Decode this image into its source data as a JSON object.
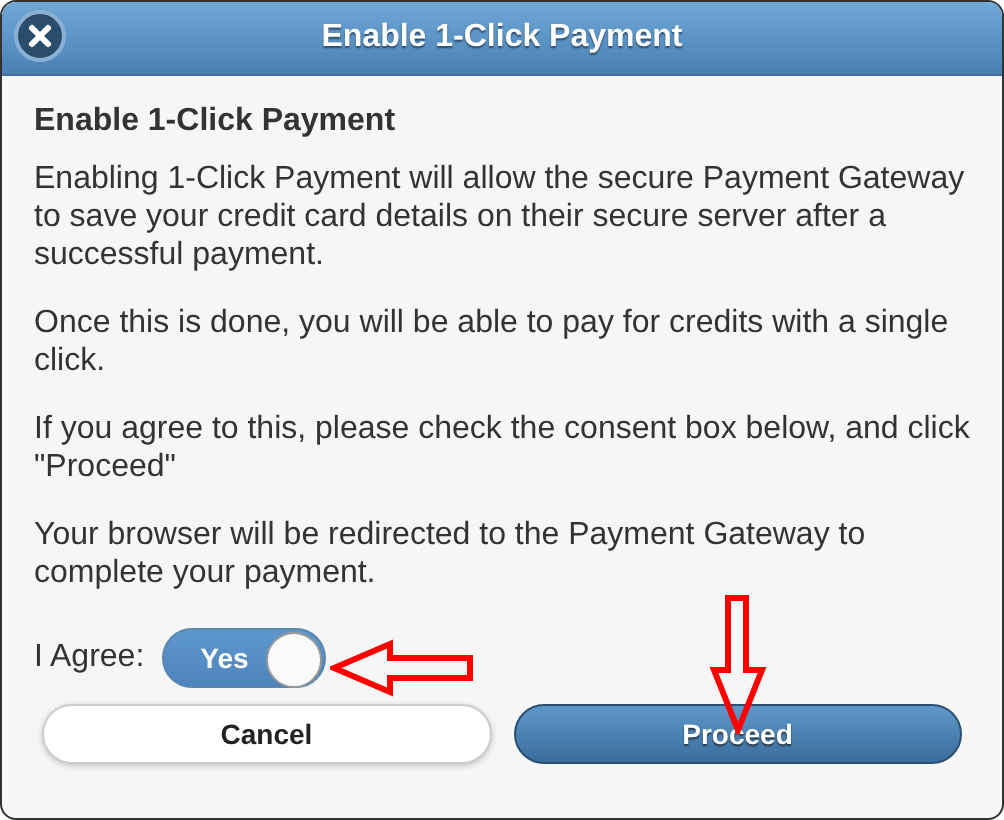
{
  "window": {
    "title": "Enable 1-Click Payment"
  },
  "heading": "Enable 1-Click Payment",
  "paragraphs": [
    "Enabling 1-Click Payment will allow the secure Payment Gateway to save your credit card details on their secure server after a successful payment.",
    "Once this is done, you will be able to pay for credits with a single click.",
    "If you agree to this, please check the consent box below, and click \"Proceed\"",
    "Your browser will be redirected to the Payment Gateway to complete your payment."
  ],
  "consent": {
    "label": "I Agree:",
    "toggle_text": "Yes",
    "on": true
  },
  "buttons": [
    {
      "label": "Cancel",
      "kind": "secondary"
    },
    {
      "label": "Proceed",
      "kind": "primary"
    }
  ]
}
